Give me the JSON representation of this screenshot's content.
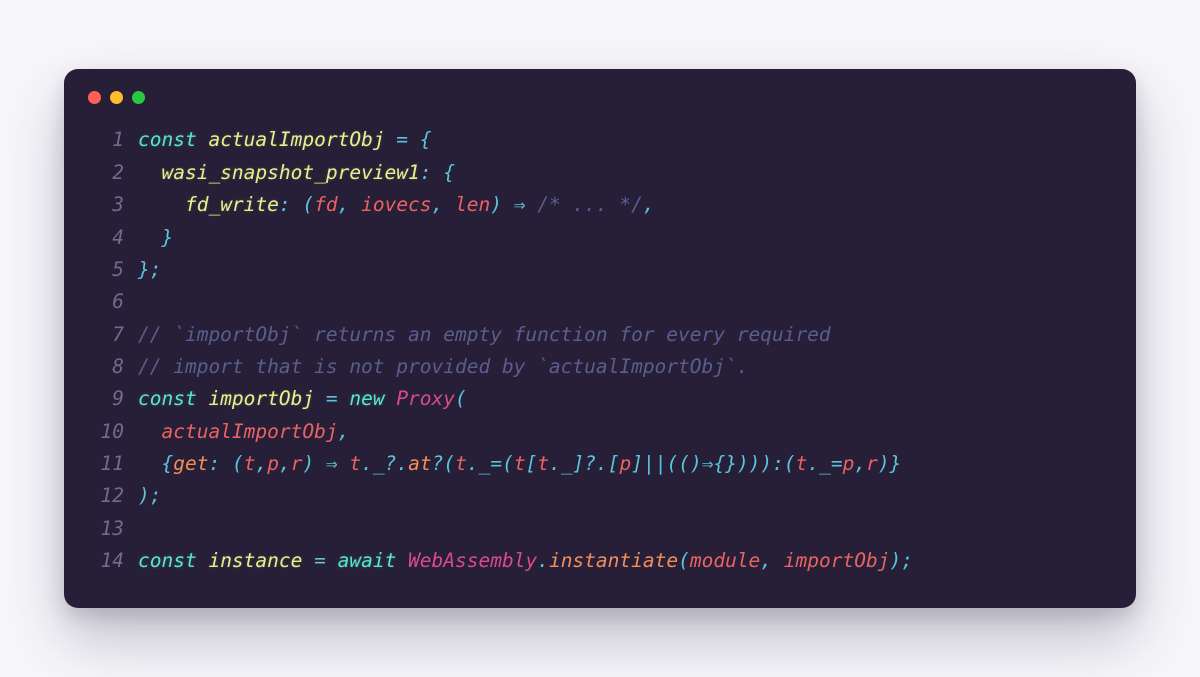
{
  "window": {
    "buttons": [
      "close",
      "minimize",
      "zoom"
    ]
  },
  "code": {
    "lines": [
      {
        "n": "1",
        "tokens": [
          {
            "t": "const ",
            "c": "kw"
          },
          {
            "t": "actualImportObj ",
            "c": "id"
          },
          {
            "t": "= {",
            "c": "pn"
          }
        ]
      },
      {
        "n": "2",
        "tokens": [
          {
            "t": "  ",
            "c": ""
          },
          {
            "t": "wasi_snapshot_preview1",
            "c": "id"
          },
          {
            "t": ": {",
            "c": "pn"
          }
        ]
      },
      {
        "n": "3",
        "tokens": [
          {
            "t": "    ",
            "c": ""
          },
          {
            "t": "fd_write",
            "c": "id"
          },
          {
            "t": ": (",
            "c": "pn"
          },
          {
            "t": "fd",
            "c": "pr"
          },
          {
            "t": ", ",
            "c": "pn"
          },
          {
            "t": "iovecs",
            "c": "pr"
          },
          {
            "t": ", ",
            "c": "pn"
          },
          {
            "t": "len",
            "c": "pr"
          },
          {
            "t": ") ⇒ ",
            "c": "pn"
          },
          {
            "t": "/* ... */",
            "c": "cm"
          },
          {
            "t": ",",
            "c": "pn"
          }
        ]
      },
      {
        "n": "4",
        "tokens": [
          {
            "t": "  ",
            "c": ""
          },
          {
            "t": "}",
            "c": "pn"
          }
        ]
      },
      {
        "n": "5",
        "tokens": [
          {
            "t": "};",
            "c": "pn"
          }
        ]
      },
      {
        "n": "6",
        "tokens": [
          {
            "t": " ",
            "c": ""
          }
        ]
      },
      {
        "n": "7",
        "tokens": [
          {
            "t": "// `importObj` returns an empty function for every required",
            "c": "cm"
          }
        ]
      },
      {
        "n": "8",
        "tokens": [
          {
            "t": "// import that is not provided by `actualImportObj`.",
            "c": "cm"
          }
        ]
      },
      {
        "n": "9",
        "tokens": [
          {
            "t": "const ",
            "c": "kw"
          },
          {
            "t": "importObj ",
            "c": "id"
          },
          {
            "t": "= ",
            "c": "pn"
          },
          {
            "t": "new ",
            "c": "kw"
          },
          {
            "t": "Proxy",
            "c": "cl"
          },
          {
            "t": "(",
            "c": "pn"
          }
        ]
      },
      {
        "n": "10",
        "tokens": [
          {
            "t": "  ",
            "c": ""
          },
          {
            "t": "actualImportObj",
            "c": "pr"
          },
          {
            "t": ",",
            "c": "pn"
          }
        ]
      },
      {
        "n": "11",
        "tokens": [
          {
            "t": "  ",
            "c": ""
          },
          {
            "t": "{",
            "c": "pn"
          },
          {
            "t": "get",
            "c": "mt"
          },
          {
            "t": ": (",
            "c": "pn"
          },
          {
            "t": "t",
            "c": "pr"
          },
          {
            "t": ",",
            "c": "pn"
          },
          {
            "t": "p",
            "c": "pr"
          },
          {
            "t": ",",
            "c": "pn"
          },
          {
            "t": "r",
            "c": "pr"
          },
          {
            "t": ") ⇒ ",
            "c": "pn"
          },
          {
            "t": "t",
            "c": "pr"
          },
          {
            "t": "._?.",
            "c": "pn"
          },
          {
            "t": "at",
            "c": "mt"
          },
          {
            "t": "?(",
            "c": "pn"
          },
          {
            "t": "t",
            "c": "pr"
          },
          {
            "t": "._=(",
            "c": "pn"
          },
          {
            "t": "t",
            "c": "pr"
          },
          {
            "t": "[",
            "c": "pn"
          },
          {
            "t": "t",
            "c": "pr"
          },
          {
            "t": "._]?.[",
            "c": "pn"
          },
          {
            "t": "p",
            "c": "pr"
          },
          {
            "t": "]||(()⇒{}))):(",
            "c": "pn"
          },
          {
            "t": "t",
            "c": "pr"
          },
          {
            "t": "._=",
            "c": "pn"
          },
          {
            "t": "p",
            "c": "pr"
          },
          {
            "t": ",",
            "c": "pn"
          },
          {
            "t": "r",
            "c": "pr"
          },
          {
            "t": ")}",
            "c": "pn"
          }
        ]
      },
      {
        "n": "12",
        "tokens": [
          {
            "t": ");",
            "c": "pn"
          }
        ]
      },
      {
        "n": "13",
        "tokens": [
          {
            "t": " ",
            "c": ""
          }
        ]
      },
      {
        "n": "14",
        "tokens": [
          {
            "t": "const ",
            "c": "kw"
          },
          {
            "t": "instance ",
            "c": "id"
          },
          {
            "t": "= ",
            "c": "pn"
          },
          {
            "t": "await ",
            "c": "kw"
          },
          {
            "t": "WebAssembly",
            "c": "cl"
          },
          {
            "t": ".",
            "c": "pn"
          },
          {
            "t": "instantiate",
            "c": "mt"
          },
          {
            "t": "(",
            "c": "pn"
          },
          {
            "t": "module",
            "c": "pr"
          },
          {
            "t": ", ",
            "c": "pn"
          },
          {
            "t": "importObj",
            "c": "pr"
          },
          {
            "t": ");",
            "c": "pn"
          }
        ]
      }
    ]
  }
}
